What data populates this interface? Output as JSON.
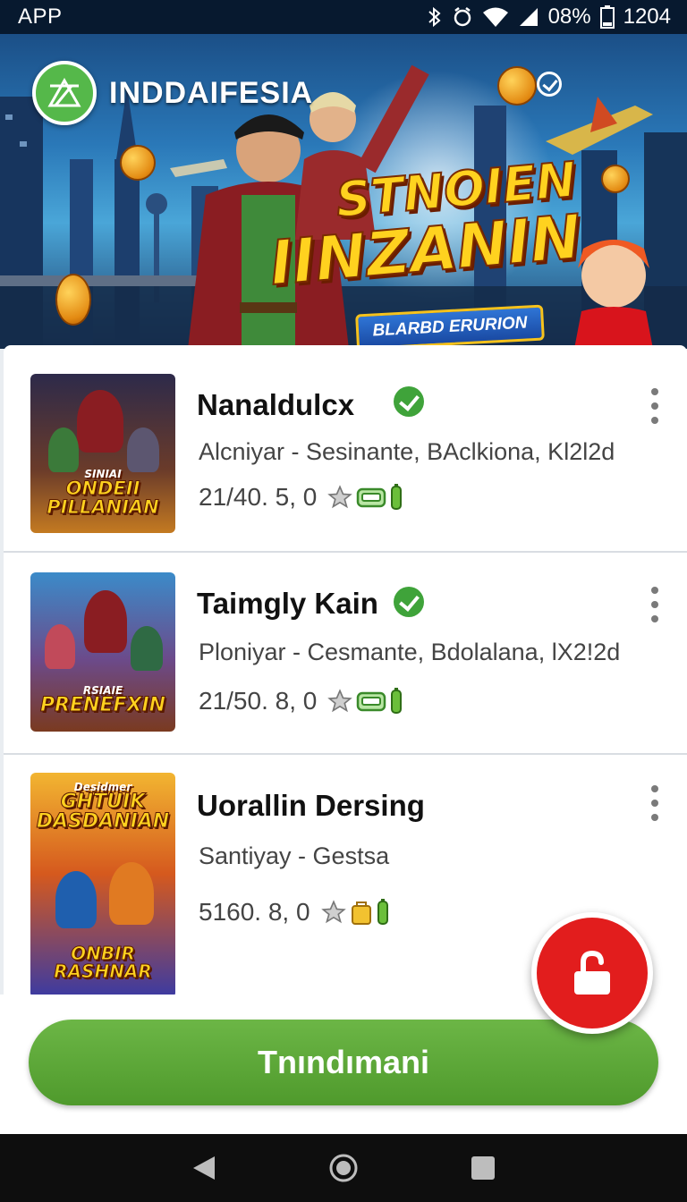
{
  "status_bar": {
    "app_label": "APP",
    "battery": "08%",
    "time": "1204",
    "icons": [
      "bluetooth-icon",
      "alarm-icon",
      "wifi-icon",
      "signal-icon",
      "battery-icon"
    ]
  },
  "banner": {
    "brand_name": "INDDAIFESIA",
    "title_line1": "STNOIEN",
    "title_line2": "IINZANIN",
    "ribbon": "BLARBD ERURION"
  },
  "games": [
    {
      "title": "Nanaldulcx",
      "verified": true,
      "subtitle": "Alcniyar - Sesinante, BAclkiona, Kl2l2d",
      "score": "21/40. 5, 0",
      "thumb_small": "SINIAI",
      "thumb_big": "ONDEII PILLANIAN",
      "meta_icons": [
        "star-icon",
        "controller-icon",
        "battery-icon"
      ]
    },
    {
      "title": "Taimgly Kain",
      "verified": true,
      "subtitle": "Ploniyar - Cesmante, Bdolalana, lX2!2d",
      "score": "21/50. 8, 0",
      "thumb_small": "RSIAIE",
      "thumb_big": "PRENEFXIN",
      "meta_icons": [
        "star-icon",
        "controller-icon",
        "battery-icon"
      ]
    },
    {
      "title": "Uorallin Dersing",
      "verified": false,
      "subtitle": "Santiyay - Gestsa",
      "score": "5160. 8, 0",
      "thumb_small": "Desidmer",
      "thumb_big": "GHTUIK DASDANIAN",
      "thumb_bottom": "ONBIR RASHNAR",
      "meta_icons": [
        "star-icon",
        "bag-icon",
        "battery-icon"
      ]
    }
  ],
  "cta": {
    "label": "Tnındımani"
  },
  "colors": {
    "primary_green": "#5aa636",
    "fab_red": "#e21d1d",
    "status_bg": "#07192f"
  }
}
